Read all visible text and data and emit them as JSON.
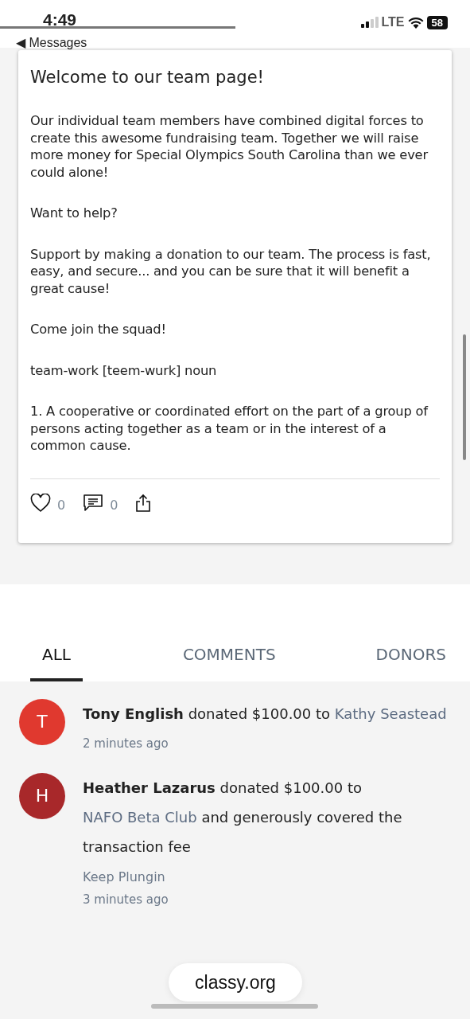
{
  "status_bar": {
    "time": "4:49",
    "back": "◀ Messages",
    "network": "LTE",
    "battery": "58"
  },
  "post": {
    "title": "Welcome to our team page!",
    "paragraphs": [
      "Our individual team members have combined digital forces to create this awesome fundraising team. Together we will raise more money for Special Olympics South Carolina than we ever could alone!",
      "Want to help?",
      "Support by making a donation to our team. The process is fast, easy, and secure... and you can be sure that it will benefit a great cause!",
      "Come join the squad!",
      "team-work [teem-wurk] noun",
      "1. A cooperative or coordinated effort on the part of a group of persons acting together as a team or in the interest of a common cause."
    ],
    "likes": "0",
    "comments": "0"
  },
  "tabs": [
    {
      "label": "ALL",
      "selected": true
    },
    {
      "label": "COMMENTS",
      "selected": false
    },
    {
      "label": "DONORS",
      "selected": false
    }
  ],
  "feed": [
    {
      "initial": "T",
      "color": "#e0392f",
      "parts": [
        {
          "kind": "name",
          "text": "Tony English"
        },
        {
          "kind": "plain",
          "text": "donated $100.00 to"
        },
        {
          "kind": "link",
          "text": "Kathy Seastead"
        }
      ],
      "time": "2 minutes ago"
    },
    {
      "initial": "H",
      "color": "#a8282a",
      "parts": [
        {
          "kind": "name",
          "text": "Heather Lazarus"
        },
        {
          "kind": "plain",
          "text": "donated $100.00 to"
        },
        {
          "kind": "link",
          "text": "NAFO Beta Club"
        },
        {
          "kind": "plain",
          "text": "and generously covered the transaction fee"
        }
      ],
      "message": "Keep Plungin",
      "time": "3 minutes ago"
    }
  ],
  "url_pill": "classy.org"
}
